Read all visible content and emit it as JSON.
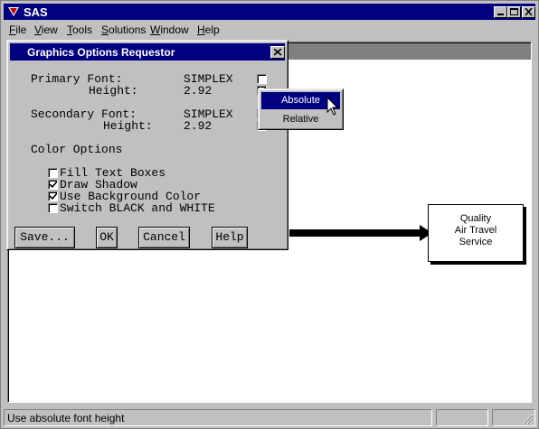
{
  "window": {
    "title": "SAS",
    "icon": "sas-logo-icon"
  },
  "menubar": {
    "items": [
      {
        "label": "File",
        "mnemonic": "F"
      },
      {
        "label": "View",
        "mnemonic": "V"
      },
      {
        "label": "Tools",
        "mnemonic": "T"
      },
      {
        "label": "Solutions",
        "mnemonic": "S"
      },
      {
        "label": "Window",
        "mnemonic": "W"
      },
      {
        "label": "Help",
        "mnemonic": "H"
      }
    ]
  },
  "canvas": {
    "box_lines": [
      "Quality",
      "Air Travel",
      "Service"
    ]
  },
  "dialog": {
    "title": "Graphics Options Requestor",
    "primary_font_label": "Primary Font:",
    "primary_font_value": "SIMPLEX",
    "primary_height_label": "Height:",
    "primary_height_value": "2.92",
    "secondary_font_label": "Secondary Font:",
    "secondary_font_value": "SIMPLEX",
    "secondary_height_label": "Height:",
    "secondary_height_value": "2.92",
    "color_options_label": "Color Options",
    "checkboxes": [
      {
        "label": "Fill Text Boxes",
        "checked": false
      },
      {
        "label": "Draw Shadow",
        "checked": true
      },
      {
        "label": "Use Background Color",
        "checked": true
      },
      {
        "label": "Switch BLACK and WHITE",
        "checked": false
      }
    ],
    "buttons": {
      "save": "Save...",
      "ok": "OK",
      "cancel": "Cancel",
      "help": "Help"
    }
  },
  "popup_menu": {
    "items": [
      {
        "label": "Absolute",
        "selected": true
      },
      {
        "label": "Relative",
        "selected": false
      }
    ]
  },
  "statusbar": {
    "text": "Use absolute font height"
  },
  "colors": {
    "title_active": "#000080",
    "title_inactive": "#808080",
    "face": "#c0c0c0"
  }
}
